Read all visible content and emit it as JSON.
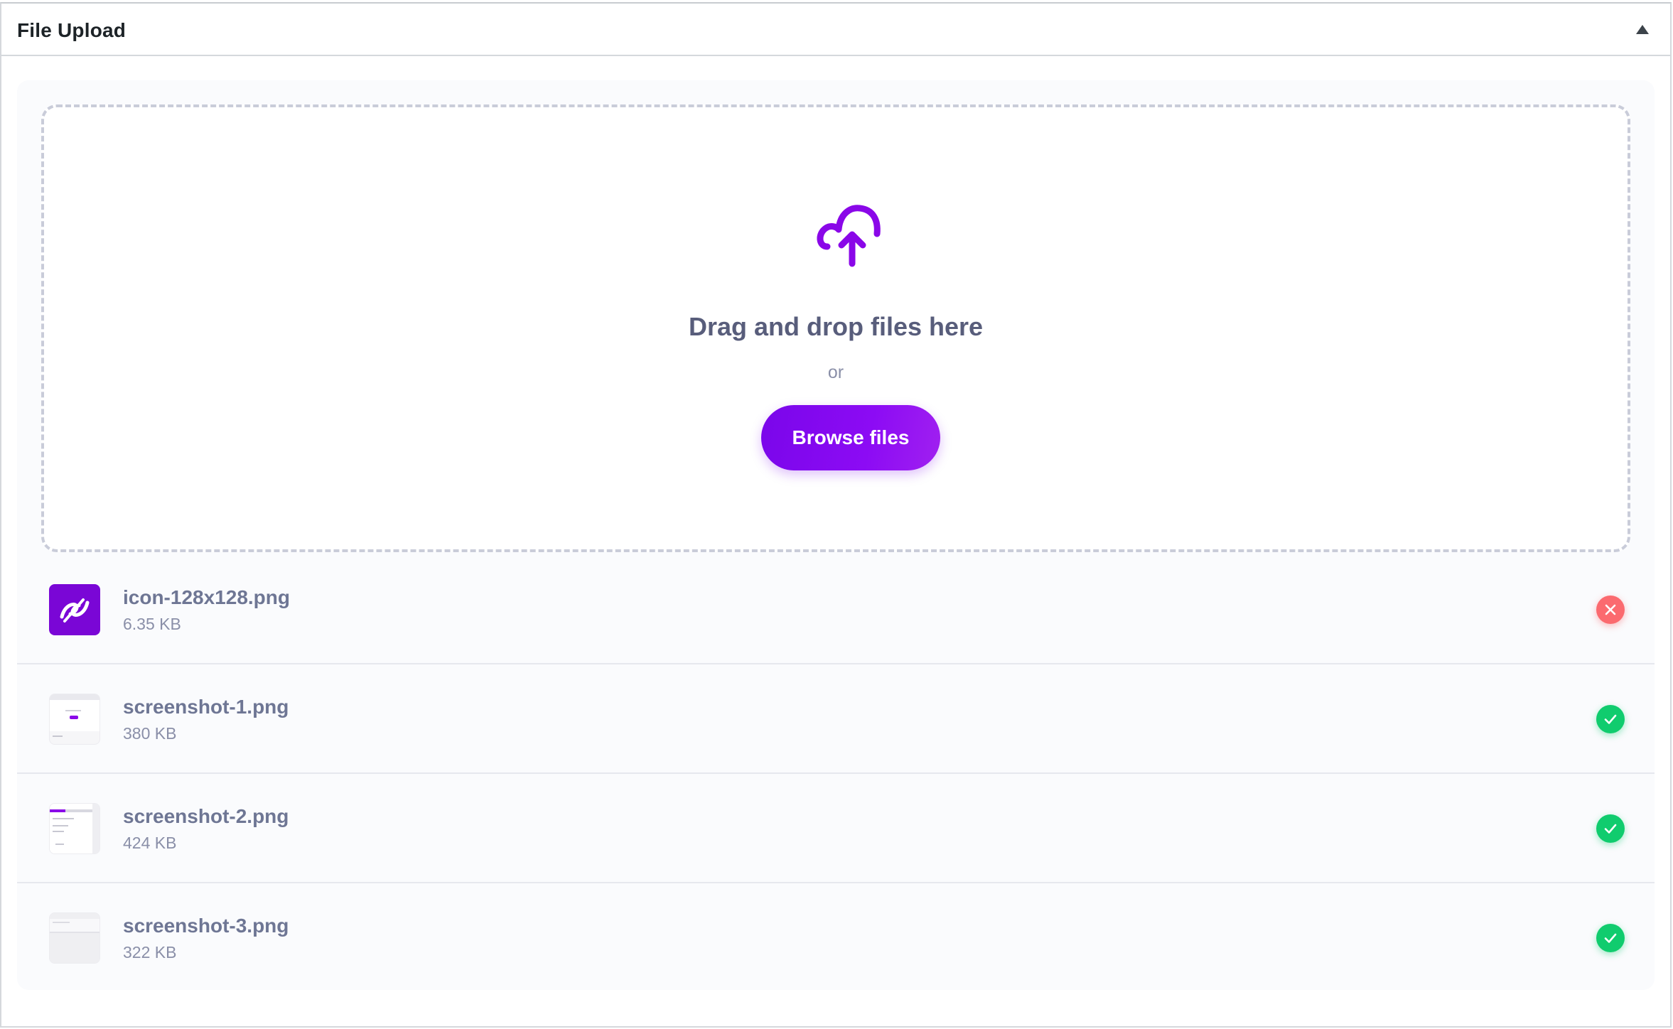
{
  "panel": {
    "title": "File Upload"
  },
  "dropzone": {
    "title": "Drag and drop files here",
    "or_text": "or",
    "browse_label": "Browse files",
    "accent_color": "#7a06ea"
  },
  "files": [
    {
      "name": "icon-128x128.png",
      "size": "6.35 KB",
      "status": "error",
      "thumb": "logo"
    },
    {
      "name": "screenshot-1.png",
      "size": "380 KB",
      "status": "success",
      "thumb": "screenshot"
    },
    {
      "name": "screenshot-2.png",
      "size": "424 KB",
      "status": "success",
      "thumb": "screenshot"
    },
    {
      "name": "screenshot-3.png",
      "size": "322 KB",
      "status": "success",
      "thumb": "screenshot"
    }
  ],
  "status_colors": {
    "error": "#fb6a6f",
    "success": "#10cc6e"
  }
}
